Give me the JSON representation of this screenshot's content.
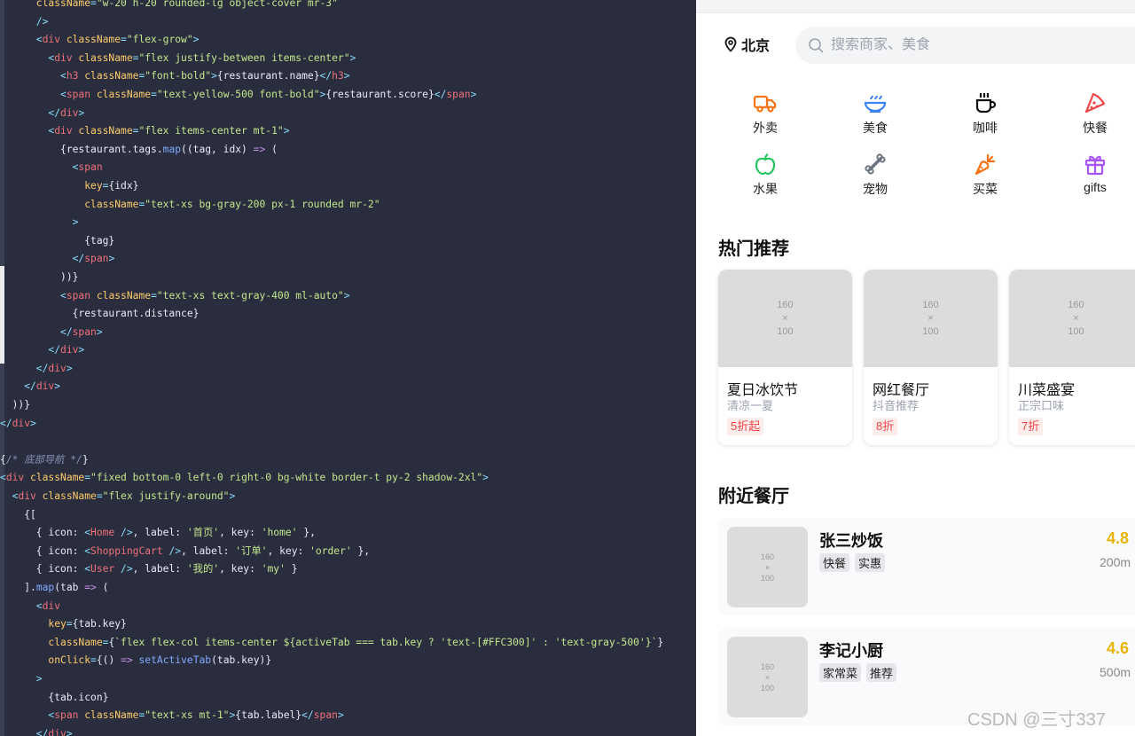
{
  "editor": {
    "lines": [
      [
        [
          "t-attr",
          "      className"
        ],
        [
          "t-punc",
          "="
        ],
        [
          "t-str",
          "\"w-20 h-20 rounded-lg object-cover mr-3\""
        ]
      ],
      [
        [
          "t-punc",
          "      />"
        ]
      ],
      [
        [
          "t-punc",
          "      <"
        ],
        [
          "t-tag",
          "div"
        ],
        [
          "t-attr",
          " className"
        ],
        [
          "t-punc",
          "="
        ],
        [
          "t-str",
          "\"flex-grow\""
        ],
        [
          "t-punc",
          ">"
        ]
      ],
      [
        [
          "t-punc",
          "        <"
        ],
        [
          "t-tag",
          "div"
        ],
        [
          "t-attr",
          " className"
        ],
        [
          "t-punc",
          "="
        ],
        [
          "t-str",
          "\"flex justify-between items-center\""
        ],
        [
          "t-punc",
          ">"
        ]
      ],
      [
        [
          "t-punc",
          "          <"
        ],
        [
          "t-tag",
          "h3"
        ],
        [
          "t-attr",
          " className"
        ],
        [
          "t-punc",
          "="
        ],
        [
          "t-str",
          "\"font-bold\""
        ],
        [
          "t-punc",
          ">"
        ],
        [
          "t-plain",
          "{restaurant.name}"
        ],
        [
          "t-punc",
          "</"
        ],
        [
          "t-tag",
          "h3"
        ],
        [
          "t-punc",
          ">"
        ]
      ],
      [
        [
          "t-punc",
          "          <"
        ],
        [
          "t-tag",
          "span"
        ],
        [
          "t-attr",
          " className"
        ],
        [
          "t-punc",
          "="
        ],
        [
          "t-str",
          "\"text-yellow-500 font-bold\""
        ],
        [
          "t-punc",
          ">"
        ],
        [
          "t-plain",
          "{restaurant.score}"
        ],
        [
          "t-punc",
          "</"
        ],
        [
          "t-tag",
          "span"
        ],
        [
          "t-punc",
          ">"
        ]
      ],
      [
        [
          "t-punc",
          "        </"
        ],
        [
          "t-tag",
          "div"
        ],
        [
          "t-punc",
          ">"
        ]
      ],
      [
        [
          "t-punc",
          "        <"
        ],
        [
          "t-tag",
          "div"
        ],
        [
          "t-attr",
          " className"
        ],
        [
          "t-punc",
          "="
        ],
        [
          "t-str",
          "\"flex items-center mt-1\""
        ],
        [
          "t-punc",
          ">"
        ]
      ],
      [
        [
          "t-plain",
          "          {restaurant.tags."
        ],
        [
          "t-fn",
          "map"
        ],
        [
          "t-plain",
          "((tag, idx) "
        ],
        [
          "t-kw",
          "=>"
        ],
        [
          "t-plain",
          " ("
        ]
      ],
      [
        [
          "t-punc",
          "            <"
        ],
        [
          "t-tag",
          "span"
        ]
      ],
      [
        [
          "t-attr",
          "              key"
        ],
        [
          "t-punc",
          "="
        ],
        [
          "t-plain",
          "{idx}"
        ]
      ],
      [
        [
          "t-attr",
          "              className"
        ],
        [
          "t-punc",
          "="
        ],
        [
          "t-str",
          "\"text-xs bg-gray-200 px-1 rounded mr-2\""
        ]
      ],
      [
        [
          "t-punc",
          "            >"
        ]
      ],
      [
        [
          "t-plain",
          "              {tag}"
        ]
      ],
      [
        [
          "t-punc",
          "            </"
        ],
        [
          "t-tag",
          "span"
        ],
        [
          "t-punc",
          ">"
        ]
      ],
      [
        [
          "t-plain",
          "          ))}"
        ]
      ],
      [
        [
          "t-punc",
          "          <"
        ],
        [
          "t-tag",
          "span"
        ],
        [
          "t-attr",
          " className"
        ],
        [
          "t-punc",
          "="
        ],
        [
          "t-str",
          "\"text-xs text-gray-400 ml-auto\""
        ],
        [
          "t-punc",
          ">"
        ]
      ],
      [
        [
          "t-plain",
          "            {restaurant.distance}"
        ]
      ],
      [
        [
          "t-punc",
          "          </"
        ],
        [
          "t-tag",
          "span"
        ],
        [
          "t-punc",
          ">"
        ]
      ],
      [
        [
          "t-punc",
          "        </"
        ],
        [
          "t-tag",
          "div"
        ],
        [
          "t-punc",
          ">"
        ]
      ],
      [
        [
          "t-punc",
          "      </"
        ],
        [
          "t-tag",
          "div"
        ],
        [
          "t-punc",
          ">"
        ]
      ],
      [
        [
          "t-punc",
          "    </"
        ],
        [
          "t-tag",
          "div"
        ],
        [
          "t-punc",
          ">"
        ]
      ],
      [
        [
          "t-plain",
          "  ))}"
        ]
      ],
      [
        [
          "t-punc",
          "</"
        ],
        [
          "t-tag",
          "div"
        ],
        [
          "t-punc",
          ">"
        ]
      ],
      [
        [
          "t-plain",
          ""
        ]
      ],
      [
        [
          "t-plain",
          "{"
        ],
        [
          "t-cmt",
          "/* 底部导航 */"
        ],
        [
          "t-plain",
          "}"
        ]
      ],
      [
        [
          "t-punc",
          "<"
        ],
        [
          "t-tag",
          "div"
        ],
        [
          "t-attr",
          " className"
        ],
        [
          "t-punc",
          "="
        ],
        [
          "t-str",
          "\"fixed bottom-0 left-0 right-0 bg-white border-t py-2 shadow-2xl\""
        ],
        [
          "t-punc",
          ">"
        ]
      ],
      [
        [
          "t-punc",
          "  <"
        ],
        [
          "t-tag",
          "div"
        ],
        [
          "t-attr",
          " className"
        ],
        [
          "t-punc",
          "="
        ],
        [
          "t-str",
          "\"flex justify-around\""
        ],
        [
          "t-punc",
          ">"
        ]
      ],
      [
        [
          "t-plain",
          "    {["
        ]
      ],
      [
        [
          "t-plain",
          "      { icon: "
        ],
        [
          "t-punc",
          "<"
        ],
        [
          "t-tag",
          "Home"
        ],
        [
          "t-punc",
          " />"
        ],
        [
          "t-plain",
          ", label: "
        ],
        [
          "t-str",
          "'首页'"
        ],
        [
          "t-plain",
          ", key: "
        ],
        [
          "t-str",
          "'home'"
        ],
        [
          "t-plain",
          " },"
        ]
      ],
      [
        [
          "t-plain",
          "      { icon: "
        ],
        [
          "t-punc",
          "<"
        ],
        [
          "t-tag",
          "ShoppingCart"
        ],
        [
          "t-punc",
          " />"
        ],
        [
          "t-plain",
          ", label: "
        ],
        [
          "t-str",
          "'订单'"
        ],
        [
          "t-plain",
          ", key: "
        ],
        [
          "t-str",
          "'order'"
        ],
        [
          "t-plain",
          " },"
        ]
      ],
      [
        [
          "t-plain",
          "      { icon: "
        ],
        [
          "t-punc",
          "<"
        ],
        [
          "t-tag",
          "User"
        ],
        [
          "t-punc",
          " />"
        ],
        [
          "t-plain",
          ", label: "
        ],
        [
          "t-str",
          "'我的'"
        ],
        [
          "t-plain",
          ", key: "
        ],
        [
          "t-str",
          "'my'"
        ],
        [
          "t-plain",
          " }"
        ]
      ],
      [
        [
          "t-plain",
          "    ]."
        ],
        [
          "t-fn",
          "map"
        ],
        [
          "t-plain",
          "(tab "
        ],
        [
          "t-kw",
          "=>"
        ],
        [
          "t-plain",
          " ("
        ]
      ],
      [
        [
          "t-punc",
          "      <"
        ],
        [
          "t-tag",
          "div"
        ]
      ],
      [
        [
          "t-attr",
          "        key"
        ],
        [
          "t-punc",
          "="
        ],
        [
          "t-plain",
          "{tab.key}"
        ]
      ],
      [
        [
          "t-attr",
          "        className"
        ],
        [
          "t-punc",
          "="
        ],
        [
          "t-plain",
          "{"
        ],
        [
          "t-str",
          "`flex flex-col items-center ${activeTab === tab.key ? 'text-[#FFC300]' : 'text-gray-500'}`"
        ],
        [
          "t-plain",
          "}"
        ]
      ],
      [
        [
          "t-attr",
          "        onClick"
        ],
        [
          "t-punc",
          "="
        ],
        [
          "t-plain",
          "{() "
        ],
        [
          "t-kw",
          "=>"
        ],
        [
          "t-plain",
          " "
        ],
        [
          "t-fn",
          "setActiveTab"
        ],
        [
          "t-plain",
          "(tab.key)}"
        ]
      ],
      [
        [
          "t-punc",
          "      >"
        ]
      ],
      [
        [
          "t-plain",
          "        {tab.icon}"
        ]
      ],
      [
        [
          "t-punc",
          "        <"
        ],
        [
          "t-tag",
          "span"
        ],
        [
          "t-attr",
          " className"
        ],
        [
          "t-punc",
          "="
        ],
        [
          "t-str",
          "\"text-xs mt-1\""
        ],
        [
          "t-punc",
          ">"
        ],
        [
          "t-plain",
          "{tab.label}"
        ],
        [
          "t-punc",
          "</"
        ],
        [
          "t-tag",
          "span"
        ],
        [
          "t-punc",
          ">"
        ]
      ],
      [
        [
          "t-punc",
          "      </"
        ],
        [
          "t-tag",
          "div"
        ],
        [
          "t-punc",
          ">"
        ]
      ]
    ]
  },
  "preview": {
    "location": {
      "city": "北京",
      "icon": "location-pin-icon"
    },
    "search": {
      "placeholder": "搜索商家、美食",
      "icon": "search-icon"
    },
    "categories": [
      {
        "label": "外卖",
        "icon": "truck-icon",
        "color": "#f97316"
      },
      {
        "label": "美食",
        "icon": "bowl-icon",
        "color": "#3b82f6"
      },
      {
        "label": "咖啡",
        "icon": "coffee-icon",
        "color": "#111111"
      },
      {
        "label": "快餐",
        "icon": "pizza-icon",
        "color": "#ef4444"
      },
      {
        "label": "水果",
        "icon": "apple-icon",
        "color": "#22c55e"
      },
      {
        "label": "宠物",
        "icon": "bone-icon",
        "color": "#6b7280"
      },
      {
        "label": "买菜",
        "icon": "carrot-icon",
        "color": "#f97316"
      },
      {
        "label": "gifts",
        "icon": "gift-icon",
        "color": "#a855f7"
      }
    ],
    "hot_title": "热门推荐",
    "promos": [
      {
        "placeholder": [
          "160",
          "×",
          "100"
        ],
        "title": "夏日冰饮节",
        "subtitle": "清凉一夏",
        "badge": "5折起"
      },
      {
        "placeholder": [
          "160",
          "×",
          "100"
        ],
        "title": "网红餐厅",
        "subtitle": "抖音推荐",
        "badge": "8折"
      },
      {
        "placeholder": [
          "160",
          "×",
          "100"
        ],
        "title": "川菜盛宴",
        "subtitle": "正宗口味",
        "badge": "7折"
      }
    ],
    "nearby_title": "附近餐厅",
    "restaurants": [
      {
        "placeholder": [
          "160",
          "×",
          "100"
        ],
        "name": "张三炒饭",
        "tags": [
          "快餐",
          "实惠"
        ],
        "score": "4.8",
        "distance": "200m"
      },
      {
        "placeholder": [
          "160",
          "×",
          "100"
        ],
        "name": "李记小厨",
        "tags": [
          "家常菜",
          "推荐"
        ],
        "score": "4.6",
        "distance": "500m"
      }
    ],
    "watermark": "CSDN @三寸337"
  },
  "colors": {
    "accent_yellow": "#eab308",
    "badge_red": "#ef4444",
    "editor_bg": "#292d3e"
  }
}
